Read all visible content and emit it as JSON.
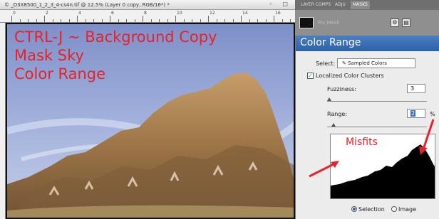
{
  "document": {
    "title": "© _D3X8500_1_2_3_4-cs4n.tif @ 12.5% (Layer 0 copy, RGB/16*) *",
    "window_buttons": "– □",
    "ruler_labels": [
      "0",
      "2",
      "4",
      "6",
      "8",
      "10",
      "12",
      "14",
      "16"
    ]
  },
  "overlay": {
    "line1": "CTRL-J ~ Background Copy",
    "line2": "Mask Sky",
    "line3": "Color Range"
  },
  "panel": {
    "tabs": [
      "LAYER COMPS",
      "ADJU",
      "MASKS"
    ],
    "active_tab": "MASKS",
    "strip_label": "Pix Mask",
    "strip_buttons": [
      "⚙",
      "▤"
    ]
  },
  "dialog": {
    "title": "Color Range",
    "select_label": "Select:",
    "select_value": "Sampled Colors",
    "localized_label": "Localized Color Clusters",
    "fuzziness_label": "Fuzziness:",
    "fuzziness_value": "3",
    "range_label": "Range:",
    "range_value": "2",
    "range_unit": "%",
    "annotation": "Misfits",
    "radio_selection": "Selection",
    "radio_image": "Image"
  },
  "colors": {
    "accent_red": "#e8212a",
    "dialog_title_blue": "#2d61a8"
  }
}
